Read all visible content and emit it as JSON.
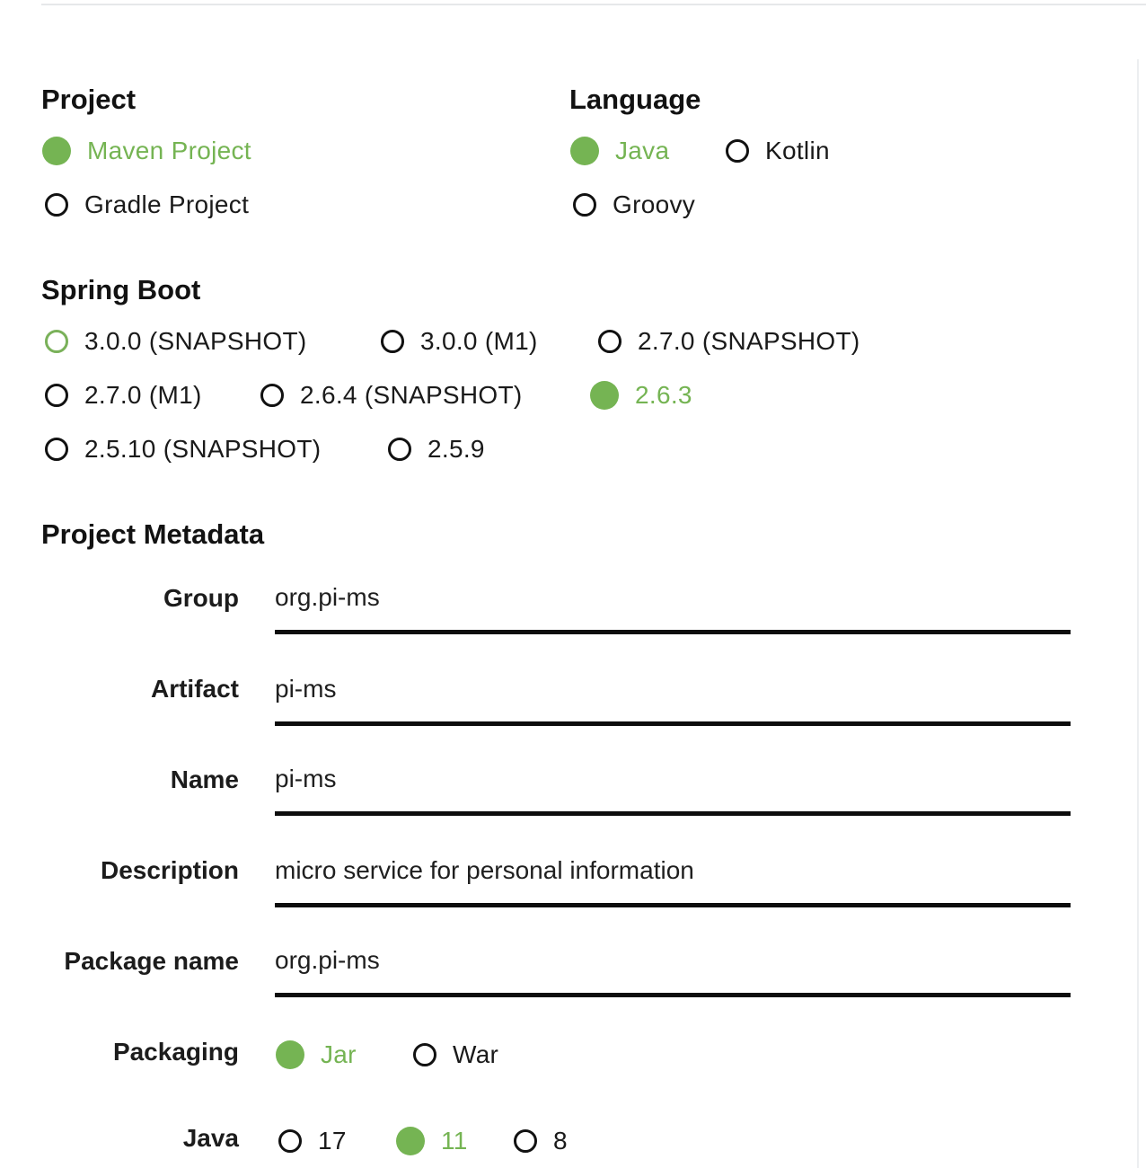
{
  "sections": {
    "project": "Project",
    "language": "Language",
    "spring_boot": "Spring Boot",
    "metadata": "Project Metadata"
  },
  "project_options": [
    {
      "label": "Maven Project",
      "selected": true
    },
    {
      "label": "Gradle Project",
      "selected": false
    }
  ],
  "language_options": [
    {
      "label": "Java",
      "selected": true
    },
    {
      "label": "Kotlin",
      "selected": false
    },
    {
      "label": "Groovy",
      "selected": false
    }
  ],
  "boot_options": [
    {
      "label": "3.0.0 (SNAPSHOT)",
      "selected": false
    },
    {
      "label": "3.0.0 (M1)",
      "selected": false
    },
    {
      "label": "2.7.0 (SNAPSHOT)",
      "selected": false
    },
    {
      "label": "2.7.0 (M1)",
      "selected": false
    },
    {
      "label": "2.6.4 (SNAPSHOT)",
      "selected": false
    },
    {
      "label": "2.6.3",
      "selected": true
    },
    {
      "label": "2.5.10 (SNAPSHOT)",
      "selected": false
    },
    {
      "label": "2.5.9",
      "selected": false
    }
  ],
  "metadata": {
    "group": {
      "label": "Group",
      "value": "org.pi-ms"
    },
    "artifact": {
      "label": "Artifact",
      "value": "pi-ms"
    },
    "name": {
      "label": "Name",
      "value": "pi-ms"
    },
    "description": {
      "label": "Description",
      "value": "micro service for personal information"
    },
    "package_name": {
      "label": "Package name",
      "value": "org.pi-ms"
    },
    "packaging": {
      "label": "Packaging"
    },
    "java": {
      "label": "Java"
    }
  },
  "packaging_options": [
    {
      "label": "Jar",
      "selected": true
    },
    {
      "label": "War",
      "selected": false
    }
  ],
  "java_options": [
    {
      "label": "17",
      "selected": false
    },
    {
      "label": "11",
      "selected": true
    },
    {
      "label": "8",
      "selected": false
    }
  ],
  "colors": {
    "accent": "#75b453",
    "text": "#1a1a1a",
    "underline": "#0d0d0d"
  }
}
